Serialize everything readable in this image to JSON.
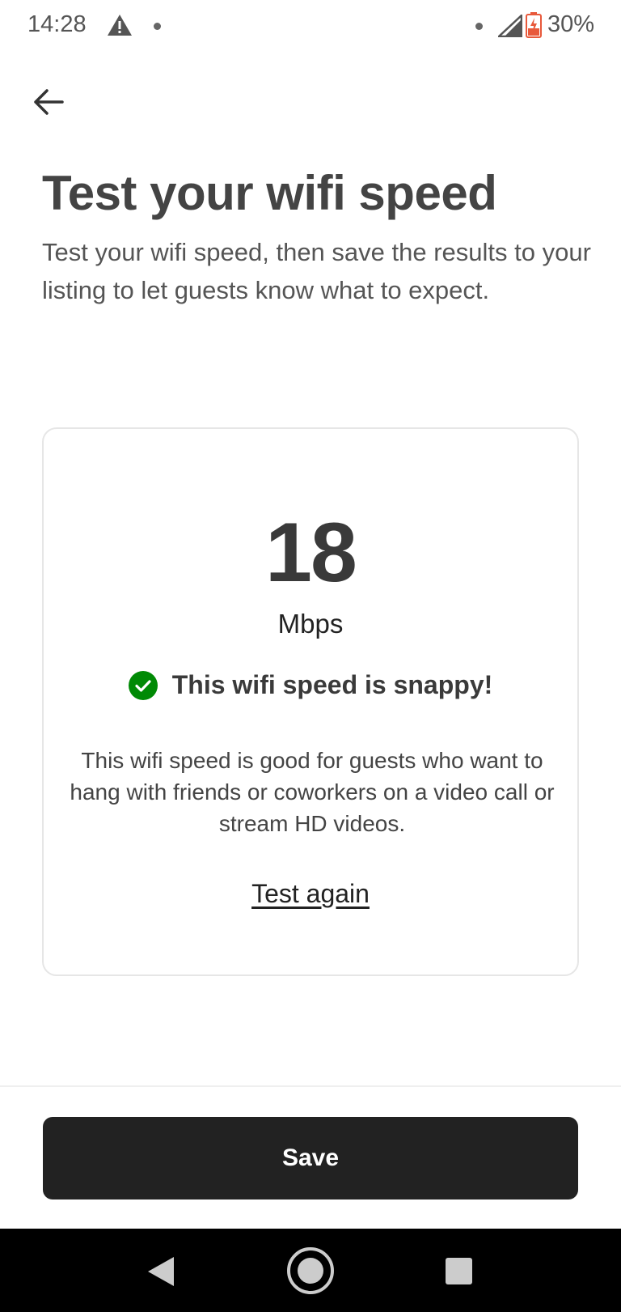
{
  "status_bar": {
    "time": "14:28",
    "battery_percent": "30%",
    "icons": [
      "warning-icon",
      "notification-dot-icon",
      "signal-icon",
      "battery-charging-icon"
    ]
  },
  "header": {
    "back_icon": "arrow-left-icon"
  },
  "page": {
    "title": "Test your wifi speed",
    "subtitle": "Test your wifi speed, then save the results to your listing to let guests know what to expect."
  },
  "result": {
    "speed_value": "18",
    "speed_unit": "Mbps",
    "rating_icon": "check-circle-icon",
    "rating_text": "This wifi speed is snappy!",
    "description": "This wifi speed is good for guests who want to hang with friends or coworkers on a video call or stream HD videos.",
    "test_again_label": "Test again"
  },
  "footer": {
    "save_label": "Save"
  },
  "nav_bar": {
    "icons": [
      "nav-back-icon",
      "nav-home-icon",
      "nav-recents-icon"
    ]
  },
  "colors": {
    "check_green": "#008A05",
    "button_dark": "#222222",
    "battery_red": "#E8593B"
  }
}
